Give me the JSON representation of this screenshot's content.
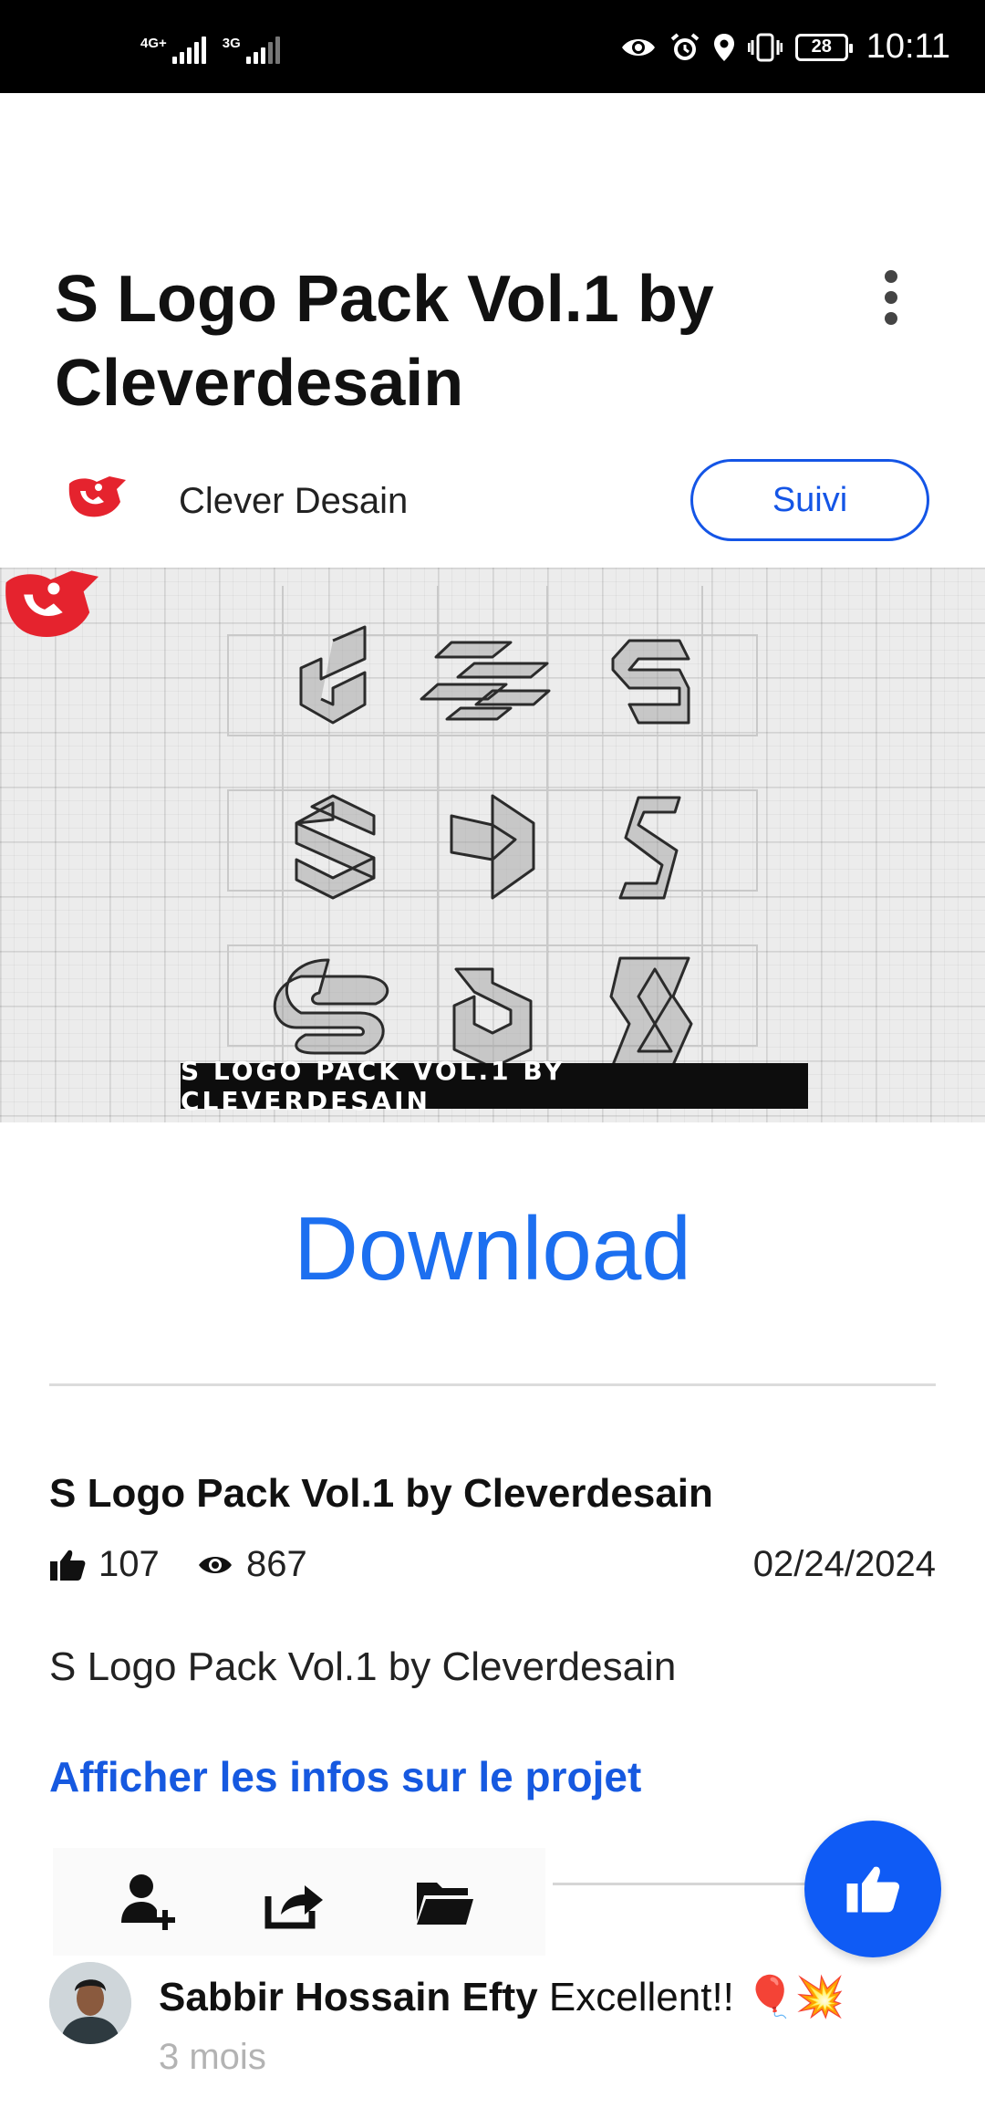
{
  "status_bar": {
    "network_1": "4G+",
    "network_2": "3G",
    "battery": "28",
    "time": "10:11"
  },
  "header": {
    "title": "S Logo Pack Vol.1 by Cleverdesain"
  },
  "author": {
    "name": "Clever Desain",
    "follow_label": "Suivi",
    "brand_color": "#e5232e"
  },
  "project_image": {
    "banner_text": "S LOGO PACK VOL.1 BY CLEVERDESAIN"
  },
  "download_label": "Download",
  "info": {
    "title": "S Logo Pack Vol.1 by Cleverdesain",
    "likes": "107",
    "views": "867",
    "date": "02/24/2024",
    "description": "S Logo Pack Vol.1 by Cleverdesain",
    "project_link": "Afficher les infos sur le projet"
  },
  "actions": {
    "icons": [
      "follow-user-icon",
      "share-icon",
      "folder-icon"
    ],
    "fab_icon": "thumbs-up-icon",
    "accent": "#0f5bf5"
  },
  "comment": {
    "author": "Sabbir Hossain Efty",
    "text": "Excellent!! 🎈💥",
    "time": "3 mois"
  }
}
